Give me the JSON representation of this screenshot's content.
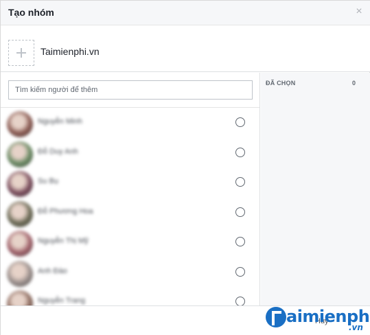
{
  "dialog": {
    "title": "Tạo nhóm",
    "close_icon": "close-icon"
  },
  "group": {
    "add_photo_icon": "plus-icon",
    "name": "Taimienphi.vn"
  },
  "search": {
    "placeholder": "Tìm kiếm người để thêm",
    "value": ""
  },
  "selected": {
    "label": "ĐÃ CHỌN",
    "count": "0"
  },
  "contacts": [
    {
      "name": "Nguyễn Minh",
      "avatar_color": "#8a5a52"
    },
    {
      "name": "Đỗ Duy Anh",
      "avatar_color": "#6a8a63"
    },
    {
      "name": "Su Bụ",
      "avatar_color": "#7a4c5c"
    },
    {
      "name": "Đỗ Phương Hoa",
      "avatar_color": "#6b6a55"
    },
    {
      "name": "Nguyễn Thị Mỹ",
      "avatar_color": "#a0616a"
    },
    {
      "name": "Anh Đào",
      "avatar_color": "#9a8f8c"
    },
    {
      "name": "Nguyễn Trang",
      "avatar_color": "#8c6a5e"
    }
  ],
  "footer": {
    "cancel_label": "Hủy"
  },
  "watermark": {
    "text": "aimienphi",
    "suffix": ".vn"
  },
  "colors": {
    "accent": "#1a6fc4",
    "header_bg": "#f6f7f9",
    "border": "#dddfe2"
  }
}
